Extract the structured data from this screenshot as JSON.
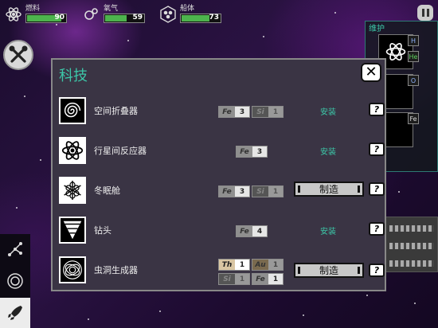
{
  "top_bar": {
    "resources": [
      {
        "label": "燃料",
        "value": "90",
        "level": 0.9,
        "icon": "atom-icon"
      },
      {
        "label": "氧气",
        "value": "59",
        "level": 0.59,
        "icon": "oxygen-icon"
      },
      {
        "label": "船体",
        "value": "73",
        "level": 0.73,
        "icon": "hull-icon"
      }
    ]
  },
  "maintenance": {
    "title": "维护",
    "tags": [
      "H",
      "He",
      "O",
      "Fe"
    ]
  },
  "modal": {
    "title": "科技",
    "close_label": "✕",
    "rows": [
      {
        "name": "空间折叠器",
        "icon": "spiral-icon",
        "materials": [
          {
            "sym": "Fe",
            "cnt": "3"
          },
          {
            "sym": "Si",
            "cnt": "1"
          }
        ],
        "action": "安装",
        "help": "?"
      },
      {
        "name": "行星间反应器",
        "icon": "atom-icon",
        "materials": [
          {
            "sym": "Fe",
            "cnt": "3"
          }
        ],
        "action": "安装",
        "help": "?"
      },
      {
        "name": "冬眠舱",
        "icon": "snowflake-icon",
        "materials": [
          {
            "sym": "Fe",
            "cnt": "3"
          },
          {
            "sym": "Si",
            "cnt": "1"
          }
        ],
        "action": "制造",
        "help": "?"
      },
      {
        "name": "钻头",
        "icon": "drill-icon",
        "materials": [
          {
            "sym": "Fe",
            "cnt": "4"
          }
        ],
        "action": "安装",
        "help": "?"
      },
      {
        "name": "虫洞生成器",
        "icon": "wormhole-icon",
        "materials": [
          {
            "sym": "Th",
            "cnt": "1"
          },
          {
            "sym": "Au",
            "cnt": "1"
          },
          {
            "sym": "Si",
            "cnt": "1"
          },
          {
            "sym": "Fe",
            "cnt": "1"
          }
        ],
        "action": "制造",
        "help": "?"
      }
    ]
  },
  "colors": {
    "accent": "#3cc7a8",
    "bar_fill": "#4db34d",
    "modal_bg": "#3a3444"
  }
}
